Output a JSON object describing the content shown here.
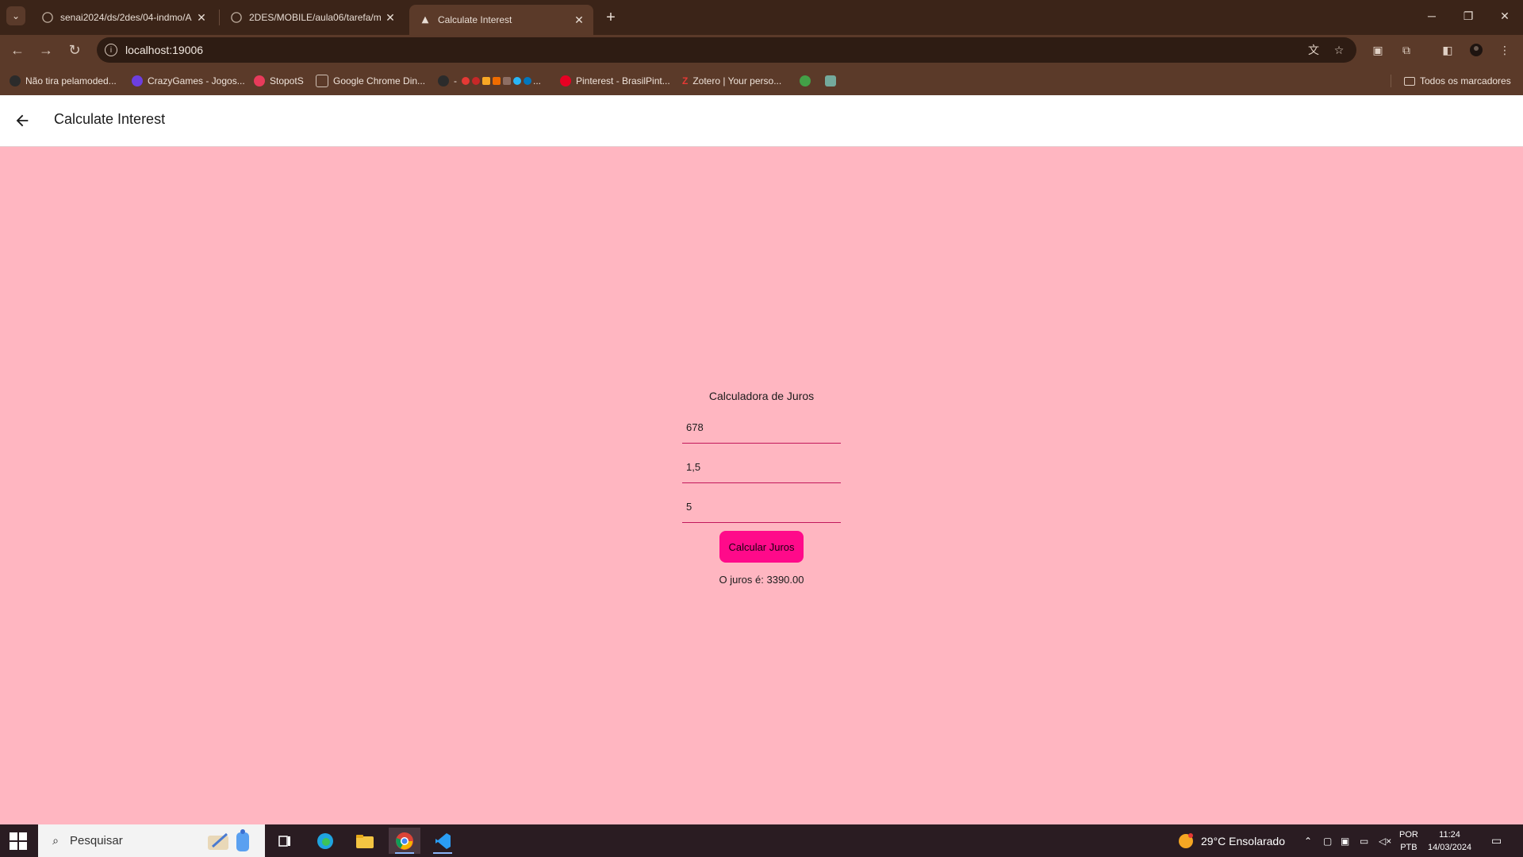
{
  "browser": {
    "tabs": [
      {
        "title": "senai2024/ds/2des/04-indmo/A"
      },
      {
        "title": "2DES/MOBILE/aula06/tarefa/m"
      },
      {
        "title": "Calculate Interest"
      }
    ],
    "url": "localhost:19006",
    "bookmarks": [
      {
        "label": "Não tira pelamoded..."
      },
      {
        "label": "CrazyGames - Jogos..."
      },
      {
        "label": "StopotS"
      },
      {
        "label": "Google Chrome Din..."
      },
      {
        "label": "-"
      },
      {
        "label": "Pinterest - BrasilPint..."
      },
      {
        "label": "Zotero | Your perso..."
      }
    ],
    "all_bookmarks_label": "Todos os marcadores"
  },
  "app": {
    "header_title": "Calculate Interest",
    "calculator": {
      "title": "Calculadora de Juros",
      "capital_value": "678",
      "rate_value": "1,5",
      "time_value": "5",
      "button_label": "Calcular Juros",
      "result_text": "O juros é: 3390.00"
    },
    "colors": {
      "background": "#ffb6c1",
      "button": "#ff0a8a",
      "input_underline": "#c2185b"
    }
  },
  "taskbar": {
    "search_placeholder": "Pesquisar",
    "weather": "29°C  Ensolarado",
    "lang_top": "POR",
    "lang_bottom": "PTB",
    "time": "11:24",
    "date": "14/03/2024"
  }
}
